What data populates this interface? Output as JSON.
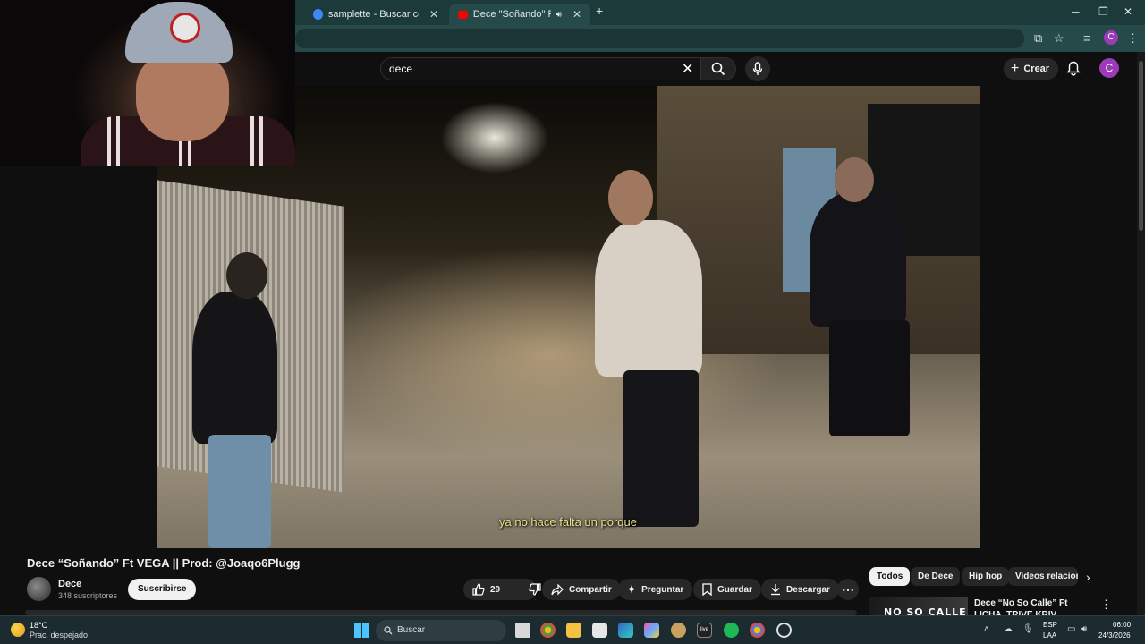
{
  "browser": {
    "tabs": [
      {
        "label": "samplette - Buscar con Google",
        "favicon_color": "#4285f4"
      },
      {
        "label": "Dece \"Soñando\" Ft VEGA ||",
        "favicon_color": "#ff0000"
      }
    ],
    "window_controls": {
      "minimize": "─",
      "maximize": "❐",
      "close": "✕"
    },
    "new_tab": "+",
    "profile_initial": "C"
  },
  "youtube": {
    "search_value": "dece",
    "create_label": "Crear",
    "avatar_initial": "C",
    "video": {
      "subtitle": "ya no hace falta un porque",
      "title": "Dece “Soñando” Ft VEGA || Prod: @Joaqo6Plugg"
    },
    "channel": {
      "name": "Dece",
      "subscribers": "348 suscriptores",
      "subscribe_label": "Suscribirse"
    },
    "actions": {
      "likes": "29",
      "share": "Compartir",
      "ask": "Preguntar",
      "save": "Guardar",
      "download": "Descargar",
      "more": "⋯"
    },
    "chips": [
      "Todos",
      "De Dece",
      "Hip hop",
      "Videos relacionados"
    ],
    "chips_next": "›",
    "recommendation": {
      "thumb_text": "NO SO CALLE",
      "title": "Dece “No So Calle” Ft LICHA, TRIVE KRIV, JOVEN SANCHEZ"
    }
  },
  "taskbar": {
    "weather_temp": "18°C",
    "weather_desc": "Prac. despejado",
    "search_placeholder": "Buscar",
    "lang_line1": "ESP",
    "lang_line2": "LAA",
    "time": "06:00",
    "date": "24/3/2026"
  },
  "colors": {
    "tab_strip": "#1d3a3a",
    "youtube_bg": "#0f0f0f",
    "accent_profile": "#9b3bb8",
    "windows_blue": "#4cc2ff"
  }
}
